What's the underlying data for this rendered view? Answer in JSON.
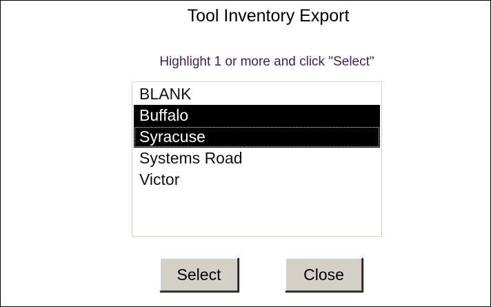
{
  "dialog": {
    "title": "Tool Inventory Export",
    "instruction": "Highlight 1 or more and click \"Select\""
  },
  "listbox": {
    "items": [
      {
        "label": "BLANK",
        "selected": false
      },
      {
        "label": "Buffalo",
        "selected": true
      },
      {
        "label": "Syracuse",
        "selected": true
      },
      {
        "label": "Systems Road",
        "selected": false
      },
      {
        "label": "Victor",
        "selected": false
      }
    ]
  },
  "buttons": {
    "select_label": "Select",
    "close_label": "Close"
  }
}
